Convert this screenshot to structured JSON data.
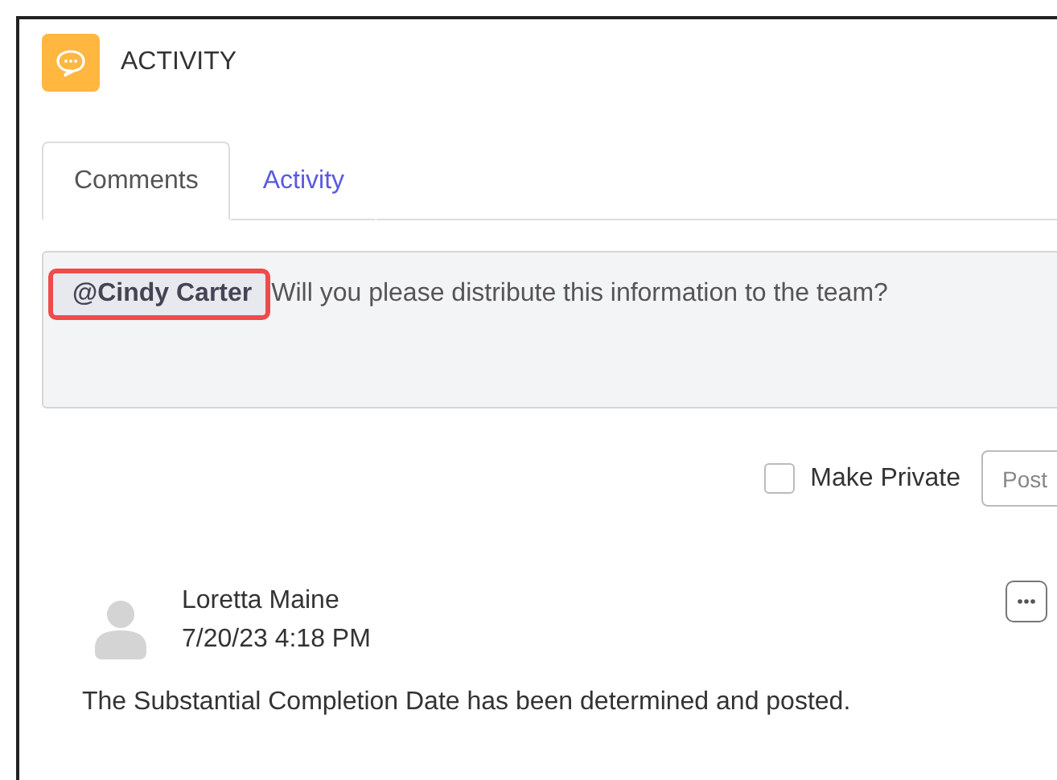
{
  "panel": {
    "title": "ACTIVITY"
  },
  "tabs": [
    {
      "label": "Comments",
      "selected": true
    },
    {
      "label": "Activity",
      "selected": false
    }
  ],
  "comment_box": {
    "mention": "@Cindy Carter",
    "mention_highlighted": true,
    "value": "Will you please distribute this information to the team?"
  },
  "make_private": {
    "label": "Make Private",
    "checked": false
  },
  "post_button": {
    "label": "Post"
  },
  "comments": [
    {
      "author": "Loretta Maine",
      "time": "7/20/23 4:18 PM",
      "text": "The Substantial Completion Date has been determined and posted."
    }
  ]
}
